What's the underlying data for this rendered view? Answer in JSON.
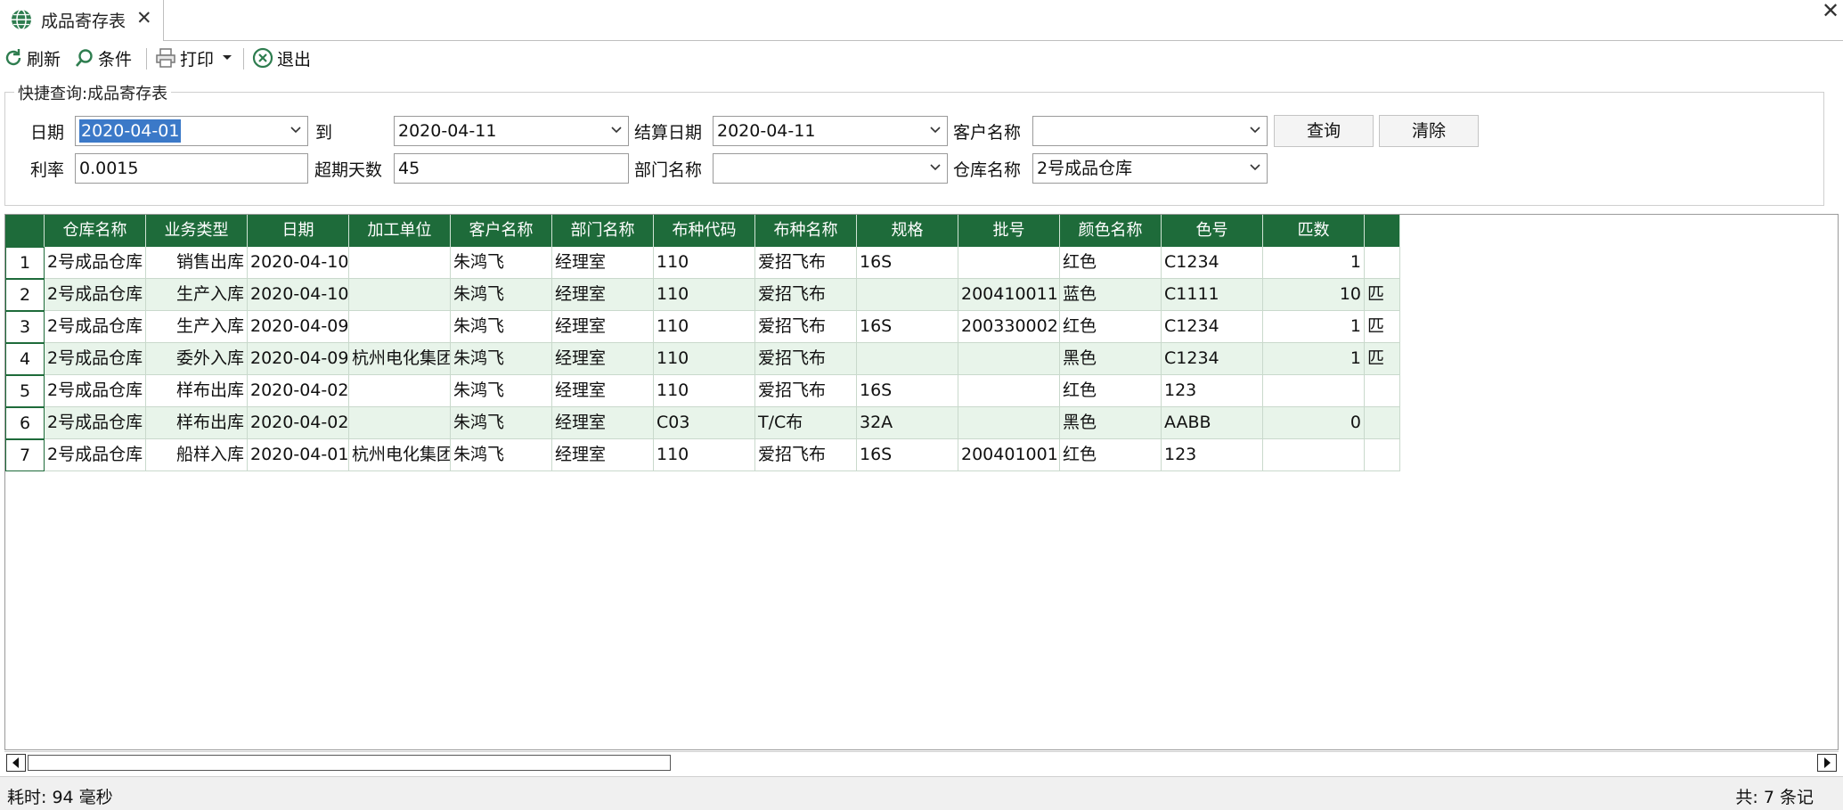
{
  "tab": {
    "title": "成品寄存表",
    "close": "✕"
  },
  "window": {
    "close": "✕"
  },
  "toolbar": {
    "refresh_label": "刷新",
    "condition_label": "条件",
    "print_label": "打印",
    "exit_label": "退出"
  },
  "query": {
    "group_title": "快捷查询:成品寄存表",
    "date_label": "日期",
    "date_from": "2020-04-01",
    "to_label": "到",
    "date_to": "2020-04-11",
    "settle_date_label": "结算日期",
    "settle_date": "2020-04-11",
    "customer_label": "客户名称",
    "customer_value": "",
    "query_button": "查询",
    "clear_button": "清除",
    "rate_label": "利率",
    "rate_value": "0.0015",
    "overdue_label": "超期天数",
    "overdue_value": "45",
    "dept_label": "部门名称",
    "dept_value": "",
    "warehouse_label": "仓库名称",
    "warehouse_value": "2号成品仓库"
  },
  "grid": {
    "columns": [
      "仓库名称",
      "业务类型",
      "日期",
      "加工单位",
      "客户名称",
      "部门名称",
      "布种代码",
      "布种名称",
      "规格",
      "批号",
      "颜色名称",
      "色号",
      "匹数"
    ],
    "rows": [
      {
        "num": "1",
        "cells": [
          "2号成品仓库",
          "销售出库",
          "2020-04-10",
          "",
          "朱鸿飞",
          "经理室",
          "110",
          "爱招飞布",
          "16S",
          "",
          "红色",
          "C1234",
          "1"
        ],
        "extra": ""
      },
      {
        "num": "2",
        "cells": [
          "2号成品仓库",
          "生产入库",
          "2020-04-10",
          "",
          "朱鸿飞",
          "经理室",
          "110",
          "爱招飞布",
          "",
          "200410011",
          "蓝色",
          "C1111",
          "10"
        ],
        "extra": "匹"
      },
      {
        "num": "3",
        "cells": [
          "2号成品仓库",
          "生产入库",
          "2020-04-09",
          "",
          "朱鸿飞",
          "经理室",
          "110",
          "爱招飞布",
          "16S",
          "200330002",
          "红色",
          "C1234",
          "1"
        ],
        "extra": "匹"
      },
      {
        "num": "4",
        "cells": [
          "2号成品仓库",
          "委外入库",
          "2020-04-09",
          "杭州电化集团有",
          "朱鸿飞",
          "经理室",
          "110",
          "爱招飞布",
          "",
          "",
          "黑色",
          "C1234",
          "1"
        ],
        "extra": "匹"
      },
      {
        "num": "5",
        "cells": [
          "2号成品仓库",
          "样布出库",
          "2020-04-02",
          "",
          "朱鸿飞",
          "经理室",
          "110",
          "爱招飞布",
          "16S",
          "",
          "红色",
          "123",
          ""
        ],
        "extra": ""
      },
      {
        "num": "6",
        "cells": [
          "2号成品仓库",
          "样布出库",
          "2020-04-02",
          "",
          "朱鸿飞",
          "经理室",
          "C03",
          "T/C布",
          "32A",
          "",
          "黑色",
          "AABB",
          "0"
        ],
        "extra": ""
      },
      {
        "num": "7",
        "cells": [
          "2号成品仓库",
          "船样入库",
          "2020-04-01",
          "杭州电化集团有",
          "朱鸿飞",
          "经理室",
          "110",
          "爱招飞布",
          "16S",
          "200401001",
          "红色",
          "123",
          ""
        ],
        "extra": ""
      }
    ]
  },
  "status": {
    "elapsed": "耗时: 94 毫秒",
    "total": "共: 7 条记"
  },
  "colors": {
    "header_green": "#1e6b3a",
    "row_alt": "#e8f4ea",
    "selection_blue": "#3b79c8"
  }
}
